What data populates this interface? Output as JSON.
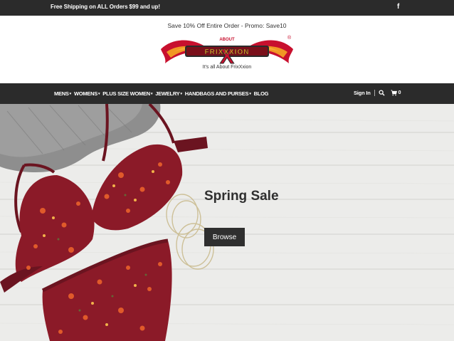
{
  "topbar": {
    "shipping_text": "Free Shipping on ALL Orders $99 and up!",
    "facebook_glyph": "f",
    "background": "#2b2b2b"
  },
  "header": {
    "promo_text": "Save 10% Off Entire Order - Promo: Save10",
    "logo": {
      "about_text": "ABOUT",
      "brand_text": "FRIXXXION",
      "registered": "®",
      "accent_colors": [
        "#c8102e",
        "#f5a623",
        "#2b2b2b"
      ]
    },
    "tagline": "It's all About FrixXxion"
  },
  "nav": {
    "items": [
      {
        "label": "MENS",
        "has_dropdown": true
      },
      {
        "label": "WOMENS",
        "has_dropdown": true
      },
      {
        "label": "PLUS SIZE WOMEN",
        "has_dropdown": true
      },
      {
        "label": "JEWELRY",
        "has_dropdown": true
      },
      {
        "label": "HANDBAGS AND PURSES",
        "has_dropdown": true
      },
      {
        "label": "BLOG",
        "has_dropdown": false
      }
    ],
    "caret_glyph": "▾",
    "signin_label": "Sign In",
    "search_icon": "search-icon",
    "cart_icon": "cart-icon",
    "cart_count": "0"
  },
  "hero": {
    "title": "Spring Sale",
    "button_label": "Browse",
    "image_subject": "lingerie-on-wood-planks"
  }
}
